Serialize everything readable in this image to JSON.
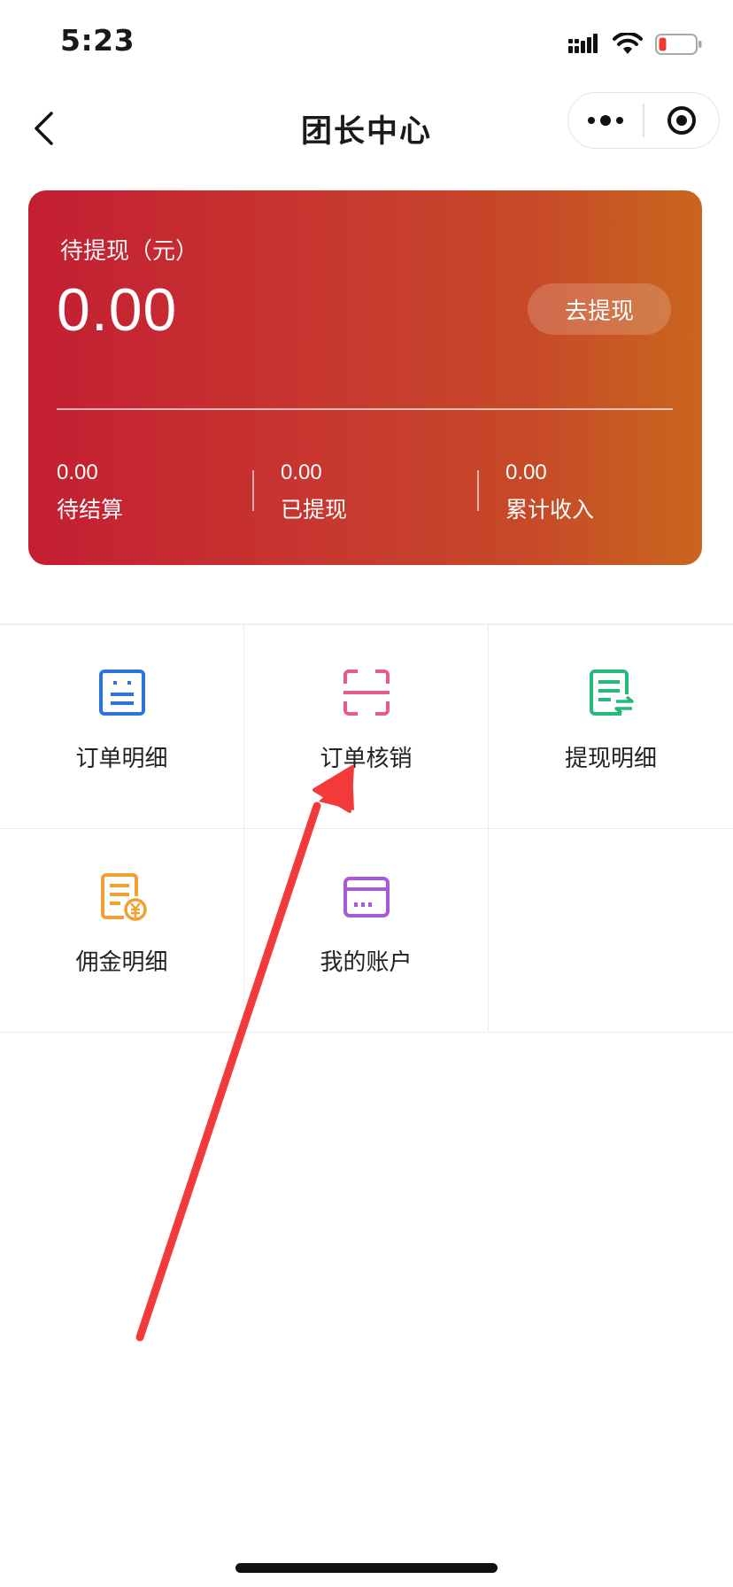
{
  "status_bar": {
    "time": "5:23"
  },
  "nav": {
    "title": "团长中心"
  },
  "balance_card": {
    "label": "待提现（元）",
    "amount": "0.00",
    "withdraw_label": "去提现",
    "stats": [
      {
        "value": "0.00",
        "label": "待结算"
      },
      {
        "value": "0.00",
        "label": "已提现"
      },
      {
        "value": "0.00",
        "label": "累计收入"
      }
    ],
    "gradient_colors": [
      "#c41e33",
      "#c9661e"
    ]
  },
  "menu": [
    {
      "label": "订单明细",
      "icon": "order-detail-icon",
      "color": "#2b74d8"
    },
    {
      "label": "订单核销",
      "icon": "scan-icon",
      "color": "#e85a8a"
    },
    {
      "label": "提现明细",
      "icon": "withdraw-detail-icon",
      "color": "#25b97b"
    },
    {
      "label": "佣金明细",
      "icon": "commission-detail-icon",
      "color": "#f0a030"
    },
    {
      "label": "我的账户",
      "icon": "account-card-icon",
      "color": "#a65ad6"
    }
  ],
  "annotation": {
    "arrow_color": "#f23a3a"
  }
}
